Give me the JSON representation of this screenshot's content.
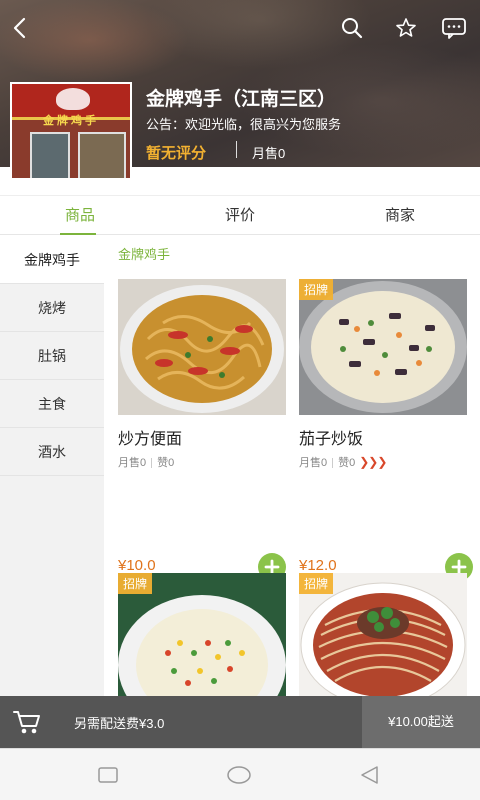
{
  "topbar": {
    "back_icon": "back-arrow-icon",
    "search_icon": "search-icon",
    "favorite_icon": "star-icon",
    "message_icon": "chat-bubble-icon"
  },
  "shop": {
    "name": "金牌鸡手（江南三区）",
    "notice": "公告：欢迎光临，很高兴为您服务",
    "rating": "暂无评分",
    "monthly_sales": "月售0",
    "image_sign_text": "金牌鸡手"
  },
  "tabs": [
    {
      "label": "商品",
      "active": true
    },
    {
      "label": "评价",
      "active": false
    },
    {
      "label": "商家",
      "active": false
    }
  ],
  "sidebar": {
    "items": [
      {
        "label": "金牌鸡手",
        "active": true
      },
      {
        "label": "烧烤",
        "active": false
      },
      {
        "label": "肚锅",
        "active": false
      },
      {
        "label": "主食",
        "active": false
      },
      {
        "label": "酒水",
        "active": false
      }
    ]
  },
  "section": {
    "title": "金牌鸡手"
  },
  "products": [
    {
      "name": "炒方便面",
      "badge": "",
      "sales": "月售0",
      "likes": "赞0",
      "spicy": "",
      "price": "¥10.0"
    },
    {
      "name": "茄子炒饭",
      "badge": "招牌",
      "sales": "月售0",
      "likes": "赞0",
      "spicy": "❯❯❯",
      "price": "¥12.0"
    },
    {
      "name": "",
      "badge": "招牌",
      "sales": "",
      "likes": "",
      "spicy": "",
      "price": ""
    },
    {
      "name": "",
      "badge": "招牌",
      "sales": "",
      "likes": "",
      "spicy": "",
      "price": ""
    }
  ],
  "cart": {
    "delivery_fee": "另需配送费¥3.0",
    "min_order": "¥10.00起送"
  },
  "colors": {
    "accent": "#7cb43c",
    "price": "#e0731b",
    "rating": "#f2b131",
    "badge": "#f2b131",
    "cart_bar": "#555555"
  }
}
